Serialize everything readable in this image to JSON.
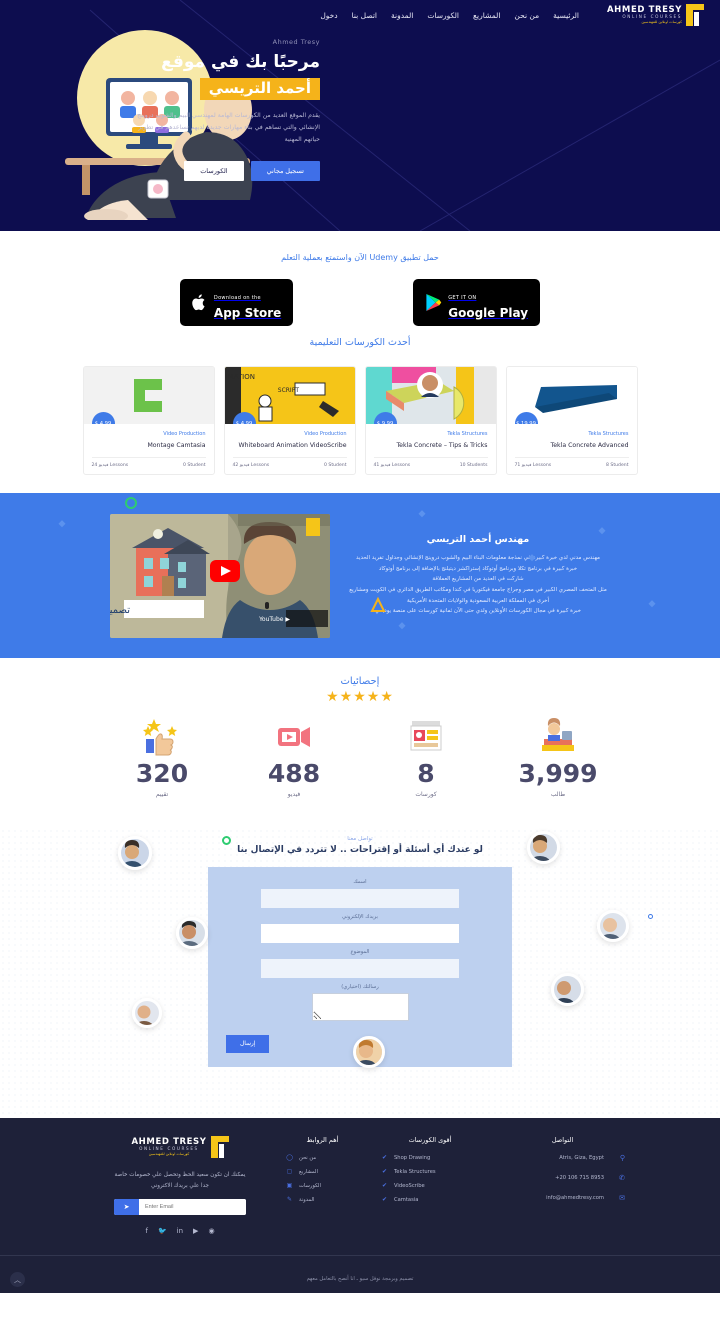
{
  "nav": {
    "logo": {
      "name": "AHMED TRESY",
      "sub": "ONLINE COURSES",
      "arabic": "كورسات اونلاين للمهندسين"
    },
    "items": [
      {
        "label": "الرئيسية"
      },
      {
        "label": "من نحن"
      },
      {
        "label": "المشاريع"
      },
      {
        "label": "الكورسات"
      },
      {
        "label": "المدونة"
      },
      {
        "label": "اتصل بنا"
      },
      {
        "label": "دخول"
      }
    ]
  },
  "hero": {
    "eyebrow": "Ahmed Tresy",
    "title": "مرحبًا بك في موقع",
    "highlight": "أحمد التريسي",
    "paragraph": "يقدم الموقع العديد من الكورسات الهامة لمهندسي البيم والشوب دروينج الإنشائي والتي تساهم في بناء مهارات جديدة لديهم تساعدهم في تطوير حياتهم المهنية",
    "btn_primary": "تسجيل مجاني",
    "btn_secondary": "الكورسات",
    "highlight_color": "#f5b31a",
    "bg_color": "#0d0d4f"
  },
  "apps": {
    "title": "حمل تطبيق Udemy الآن واستمتع بعملية التعلم",
    "google": {
      "small": "GET IT ON",
      "big": "Google Play"
    },
    "apple": {
      "small": "Download on the",
      "big": "App Store"
    }
  },
  "courses": {
    "title": "أحدث الكورسات التعليمية",
    "items": [
      {
        "category": "Tekla Structures",
        "name": "Tekla Concrete Advanced",
        "price": "$ 19.99",
        "students": "8 Student",
        "lessons": "71 فيديو Lessons"
      },
      {
        "category": "Tekla Structures",
        "name": "Tekla Concrete – Tips & Tricks",
        "price": "$ 9.99",
        "students": "10 Students",
        "lessons": "41 فيديو Lessons"
      },
      {
        "category": "Video Production",
        "name": "Whiteboard Animation VideoScribe",
        "price": "$ 4.99",
        "students": "0 Student",
        "lessons": "42 فيديو Lessons"
      },
      {
        "category": "Video Production",
        "name": "Montage Camtasia",
        "price": "$ 4.99",
        "students": "0 Student",
        "lessons": "24 فيديو Lessons"
      }
    ]
  },
  "bio": {
    "heading": "مهندس أحمد التريسي",
    "paragraph": "مهندس مدني لدي خبرة كبيرة في نمذجة معلومات البناء البيم والشوب دروينج الإنشائي وجداول تفريد الحديد\nخبرة كبيرة في برنامج تكلا وبرنامج أوتوكاد إستراكشر ديتيلنج بالإضافة إلى برنامج أوتوكاد\nشاركت في العديد من المشاريع العملاقة\nمثل المتحف المصري الكبير في مصر وجراج جامعة فيكتوريا في كندا ومكاتب الطريق الدائري في الكويت ومشاريع أخرى في المملكة العربية السعودية والولايات المتحدة الأمريكية\nخبرة كبيرة في مجال الكورسات الأونلاين ولدي حتى الآن ثمانية كورسات على منصة يوديمي",
    "video_caption": "تصميم إنشائي ومعماري",
    "video_watch": "المشاهدة على YouTube",
    "bg_color": "#3f7be8"
  },
  "stats": {
    "heading": "إحصائيات",
    "stars": "★★★★★",
    "items": [
      {
        "icon": "thumbs-up",
        "value": "320",
        "label": "تقييم"
      },
      {
        "icon": "video-camera",
        "value": "488",
        "label": "فيديو"
      },
      {
        "icon": "courses",
        "value": "8",
        "label": "كورسات"
      },
      {
        "icon": "student",
        "value": "3,999",
        "label": "طالب"
      }
    ]
  },
  "contact": {
    "eyebrow": "تواصل معنا",
    "heading": "لو عندك أي أسئلة أو إقتراحات .. لا تتردد في الإتصال بنا",
    "fields": [
      {
        "label": "اسمك",
        "value": ""
      },
      {
        "label": "بريدك الإلكتروني",
        "value": ""
      },
      {
        "label": "الموضوع",
        "value": ""
      },
      {
        "label": "رسالتك (اختياري)",
        "value": ""
      }
    ],
    "submit": "إرسال"
  },
  "footer": {
    "links_heading": "أهم الروابط",
    "links": [
      {
        "label": "من نحن",
        "icon": "circle-icon"
      },
      {
        "label": "المشاريع",
        "icon": "message-icon"
      },
      {
        "label": "الكورسات",
        "icon": "video-icon"
      },
      {
        "label": "المدونة",
        "icon": "pen-icon"
      }
    ],
    "courses_heading": "أقوى الكورسات",
    "courses": [
      {
        "label": "Shop Drawing"
      },
      {
        "label": "Tekla Structures"
      },
      {
        "label": "VideoScribe"
      },
      {
        "label": "Camtasia"
      }
    ],
    "contact_heading": "التواصل",
    "contact": [
      {
        "icon": "location-icon",
        "value": "Atris, Giza, Egypt"
      },
      {
        "icon": "whatsapp-icon",
        "value": "+20 106 715 8953"
      },
      {
        "icon": "mail-icon",
        "value": "info@ahmedtresy.com"
      }
    ],
    "brand": {
      "name": "AHMED TRESY",
      "sub": "ONLINE COURSES",
      "arabic": "كورسات اونلاين للمهندسين"
    },
    "newsletter_text": "يمكنك ان تكون سعيد الحظ وتحصل علي خصومات خاصة جدا علي بريدك الاكتروني",
    "newsletter_placeholder": "Enter Email",
    "socials": [
      "instagram",
      "youtube",
      "linkedin",
      "twitter",
      "facebook"
    ],
    "copyright": "تصميم وبرمجة نوفل سيو ـ انا أنصح بالتعامل معهم",
    "bg_color": "#1e2139"
  }
}
